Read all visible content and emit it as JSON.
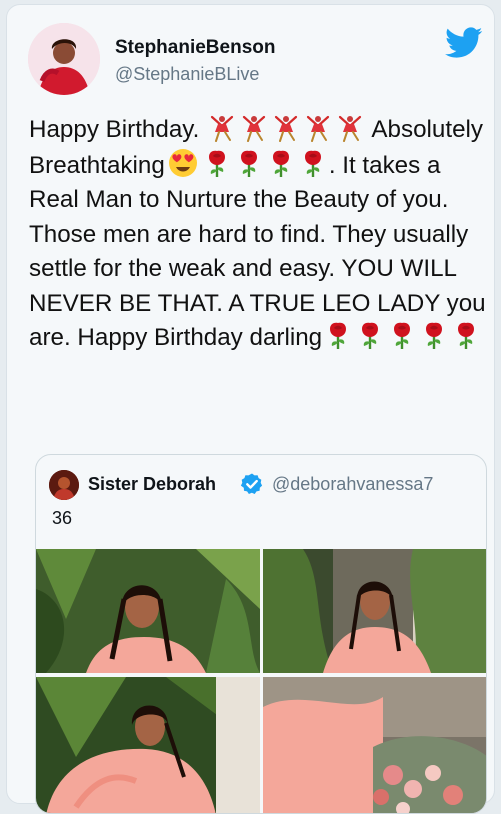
{
  "author": {
    "display_name": "StephanieBenson",
    "handle": "@StephanieBLive",
    "avatar_icon": "profile-photo",
    "platform_icon": "twitter-bird-icon"
  },
  "tweet": {
    "segments": [
      {
        "type": "text",
        "value": "Happy Birthday. "
      },
      {
        "type": "emoji",
        "name": "dancer-emoji"
      },
      {
        "type": "emoji",
        "name": "dancer-emoji"
      },
      {
        "type": "emoji",
        "name": "dancer-emoji"
      },
      {
        "type": "emoji",
        "name": "dancer-emoji"
      },
      {
        "type": "emoji",
        "name": "dancer-emoji"
      },
      {
        "type": "text",
        "value": " Absolutely Breathtaking"
      },
      {
        "type": "emoji",
        "name": "heart-eyes-emoji"
      },
      {
        "type": "emoji",
        "name": "rose-emoji"
      },
      {
        "type": "emoji",
        "name": "rose-emoji"
      },
      {
        "type": "emoji",
        "name": "rose-emoji"
      },
      {
        "type": "emoji",
        "name": "rose-emoji"
      },
      {
        "type": "text",
        "value": ". It takes a Real Man to Nurture the Beauty of you. Those men are hard to find. They usually settle for the weak and easy. YOU WILL NEVER BE THAT. A TRUE LEO LADY you are. Happy Birthday darling"
      },
      {
        "type": "emoji",
        "name": "rose-emoji"
      },
      {
        "type": "emoji",
        "name": "rose-emoji"
      },
      {
        "type": "emoji",
        "name": "rose-emoji"
      },
      {
        "type": "emoji",
        "name": "rose-emoji"
      },
      {
        "type": "emoji",
        "name": "rose-emoji"
      }
    ]
  },
  "quoted_tweet": {
    "display_name": "Sister Deborah",
    "verified_icon": "verified-badge-icon",
    "handle": "@deborahvanessa7",
    "text": "36",
    "photos": [
      "photo-1",
      "photo-2",
      "photo-3",
      "photo-4"
    ]
  },
  "colors": {
    "accent": "#1da1f2",
    "rose": "#d0121e",
    "secondary_text": "#657786",
    "dress": "#f4a79a"
  }
}
